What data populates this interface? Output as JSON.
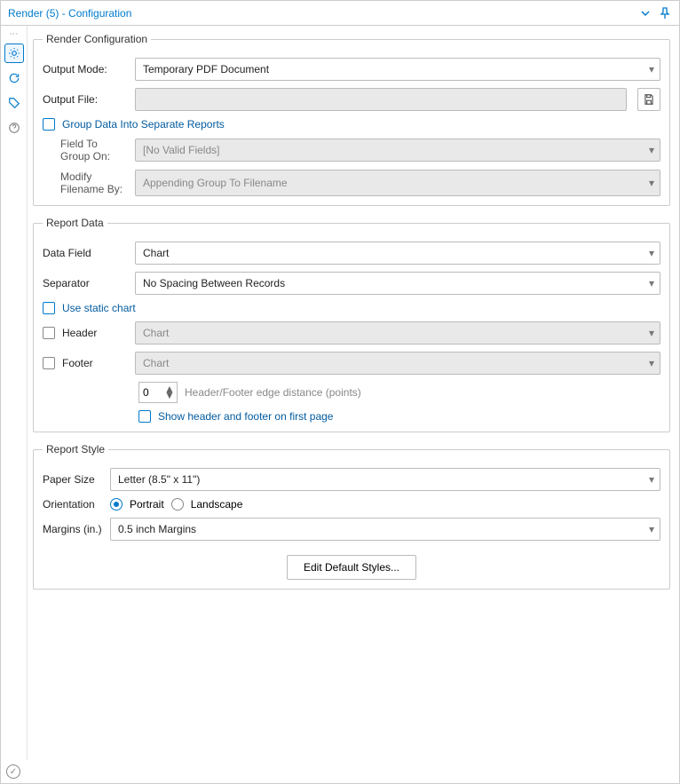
{
  "title": "Render (5) - Configuration",
  "renderConfig": {
    "legend": "Render Configuration",
    "outputModeLabel": "Output Mode:",
    "outputModeValue": "Temporary PDF Document",
    "outputFileLabel": "Output File:",
    "outputFileValue": "",
    "groupDataLabel": "Group Data Into Separate Reports",
    "fieldGroupLabel": "Field To Group On:",
    "fieldGroupValue": "[No Valid Fields]",
    "modifyFilenameLabel": "Modify Filename By:",
    "modifyFilenameValue": "Appending Group To Filename"
  },
  "reportData": {
    "legend": "Report Data",
    "dataFieldLabel": "Data Field",
    "dataFieldValue": "Chart",
    "separatorLabel": "Separator",
    "separatorValue": "No Spacing Between Records",
    "useStaticLabel": "Use static chart",
    "headerLabel": "Header",
    "headerValue": "Chart",
    "footerLabel": "Footer",
    "footerValue": "Chart",
    "edgeDistValue": "0",
    "edgeDistHint": "Header/Footer edge distance (points)",
    "showFirstPageLabel": "Show header and footer on first page"
  },
  "reportStyle": {
    "legend": "Report Style",
    "paperLabel": "Paper Size",
    "paperValue": "Letter (8.5\" x 11\")",
    "orientLabel": "Orientation",
    "portrait": "Portrait",
    "landscape": "Landscape",
    "marginsLabel": "Margins (in.)",
    "marginsValue": "0.5 inch Margins",
    "editBtn": "Edit Default Styles..."
  }
}
